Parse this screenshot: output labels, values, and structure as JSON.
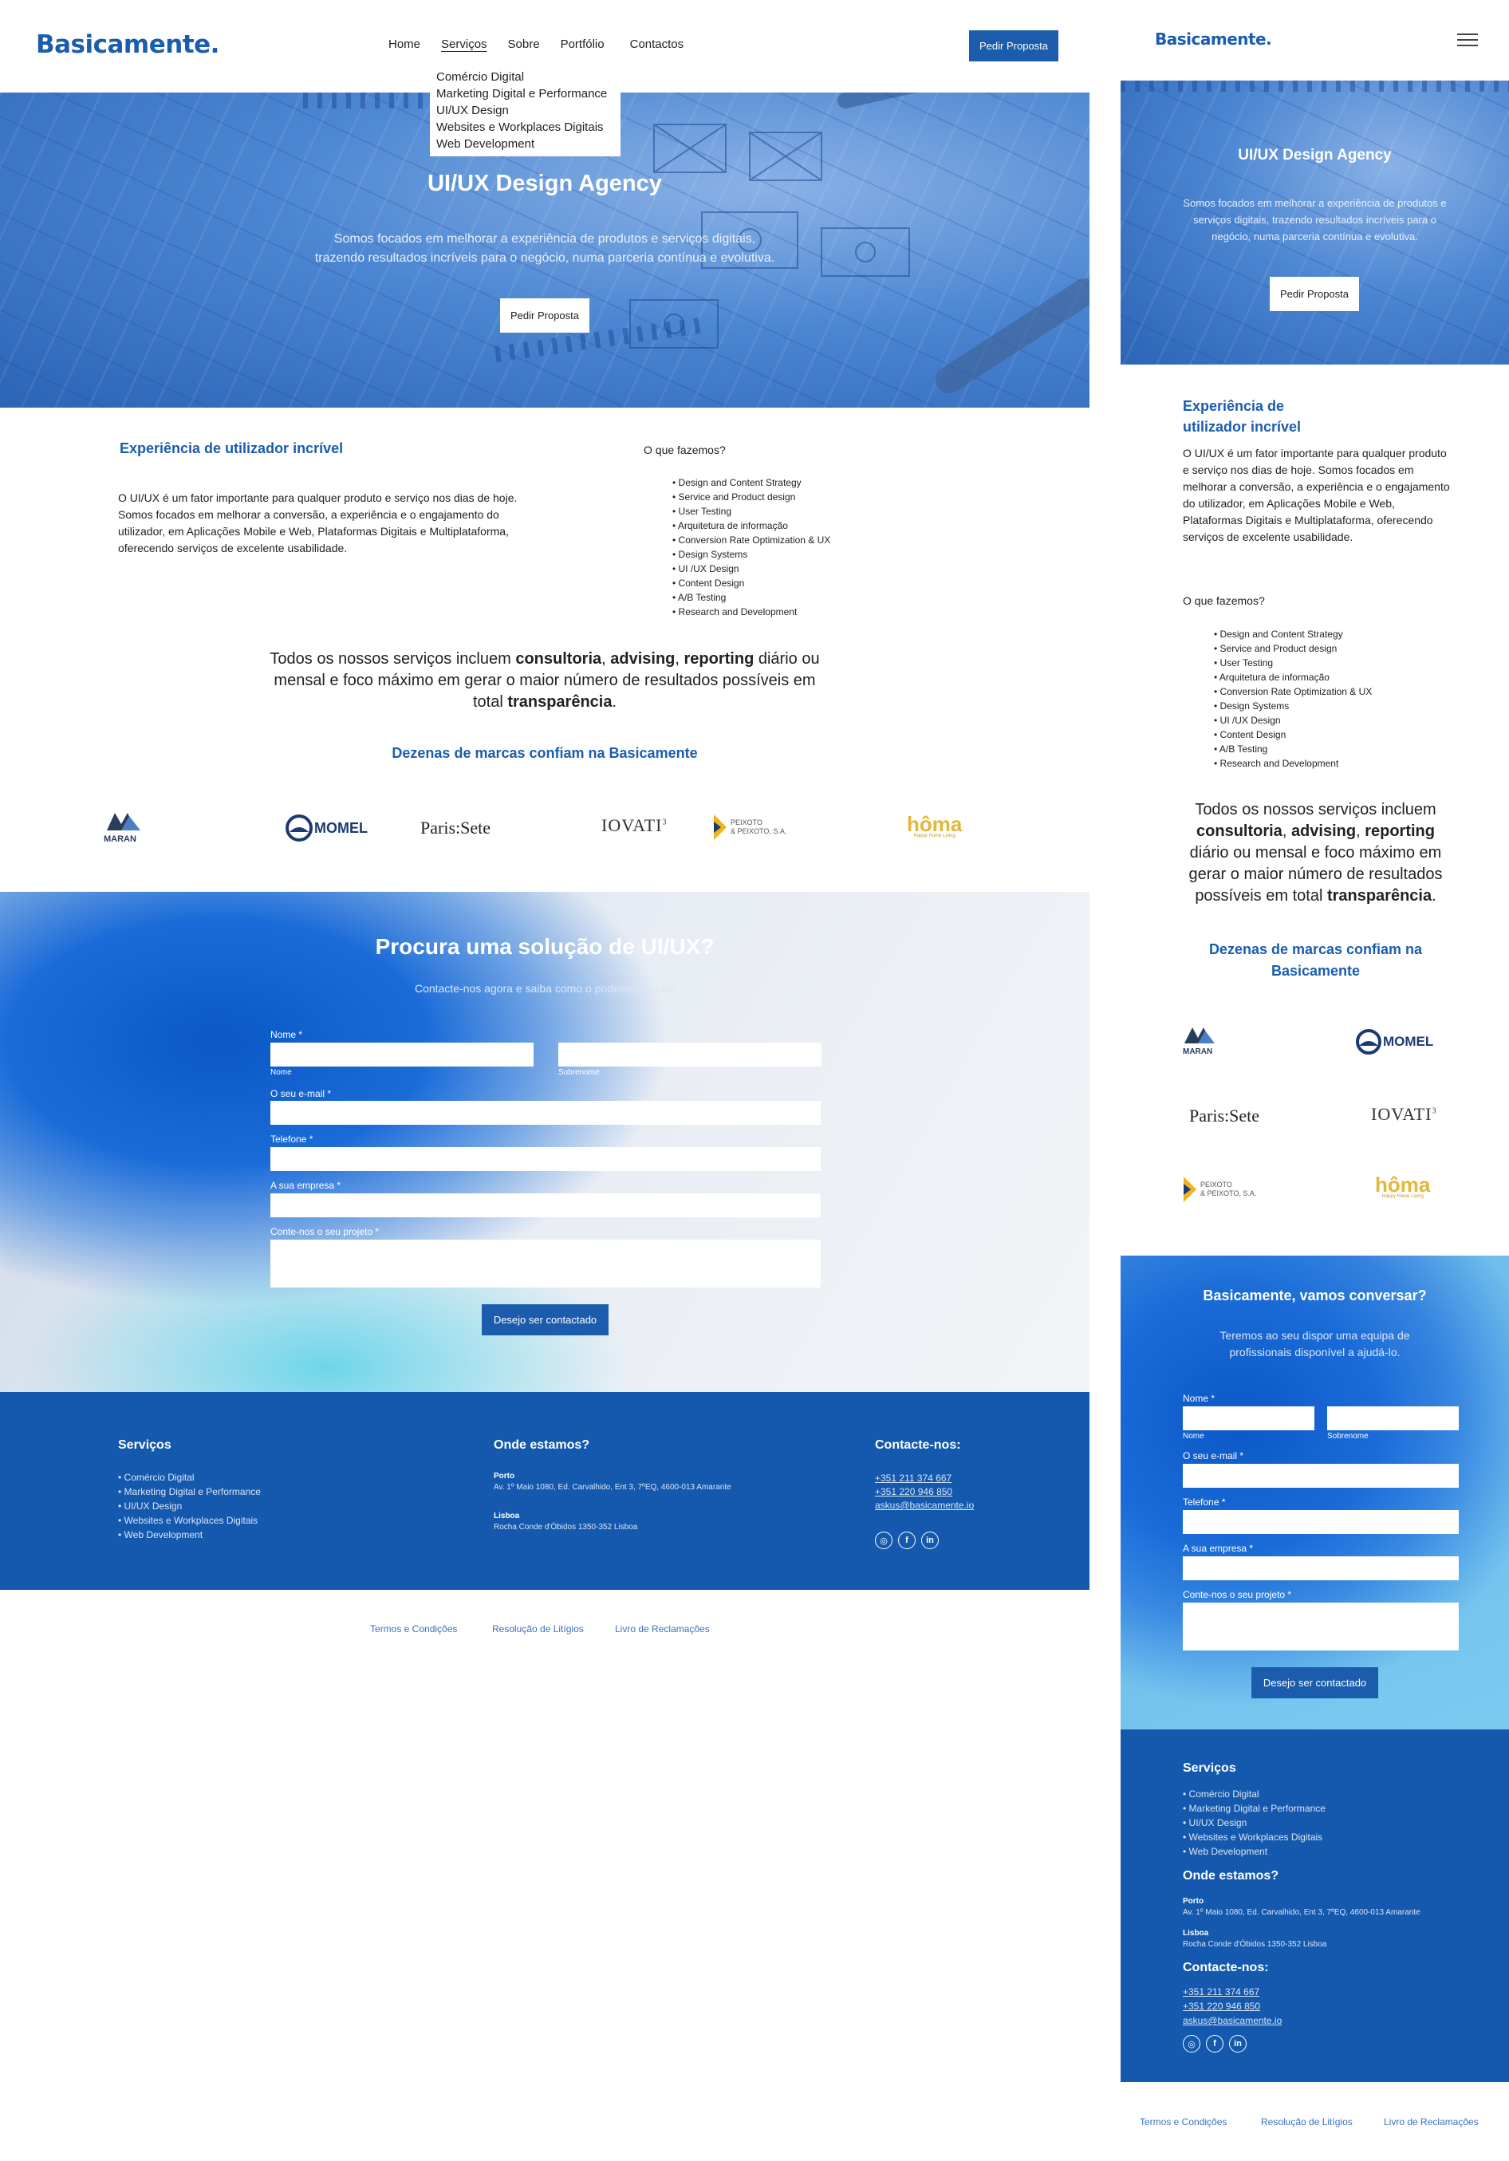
{
  "brand": {
    "name": "Basicamente",
    "dot": ".",
    "color": "#1a5cb0"
  },
  "nav": {
    "items": [
      "Home",
      "Serviços",
      "Sobre",
      "Portfólio",
      "Contactos"
    ],
    "cta": "Pedir Proposta",
    "active": "Serviços",
    "dropdown": [
      "Comércio Digital",
      "Marketing Digital e Performance",
      "UI/UX Design",
      "Websites e Workplaces Digitais",
      "Web Development"
    ]
  },
  "hero": {
    "title": "UI/UX Design Agency",
    "subtitle_line1": "Somos focados em melhorar a experiência de produtos e serviços digitais,",
    "subtitle_line2": "trazendo resultados incríveis para o negócio, numa parceria contínua e evolutiva.",
    "mobile_subtitle": "Somos focados em melhorar a experiência de produtos e serviços digitais, trazendo resultados incríveis para o negócio, numa parceria contínua e evolutiva.",
    "cta": "Pedir Proposta"
  },
  "intro": {
    "heading": "Experiência de utilizador incrível",
    "heading_m1": "Experiência de",
    "heading_m2": "utilizador incrível",
    "body": "O UI/UX é um fator importante para qualquer produto e serviço nos dias de hoje. Somos focados em melhorar a conversão, a experiência e o engajamento do utilizador, em Aplicações Mobile e Web, Plataformas Digitais e Multiplataforma, oferecendo serviços de excelente usabilidade.",
    "services_heading": "O que fazemos?",
    "services": [
      "Design and Content Strategy",
      "Service and Product design",
      "User Testing",
      "Arquitetura de informação",
      "Conversion Rate Optimization & UX",
      "Design Systems",
      "UI /UX Design",
      "Content Design",
      "A/B Testing",
      "Research and Development"
    ]
  },
  "statement": {
    "t1": "Todos os nossos serviços incluem ",
    "b1": "consultoria",
    "t2": ", ",
    "b2": "advising",
    "t3": ", ",
    "b3": "reporting",
    "t4": " diário ou mensal e foco máximo em gerar o maior número de resultados possíveis em total ",
    "b4": "transparência",
    "t5": "."
  },
  "brands": {
    "heading": "Dezenas de marcas confiam na Basicamente",
    "logos": [
      "MARAN",
      "MOMEL",
      "Paris:Sete",
      "IOVATI",
      "PEIXOTO & PEIXOTO, S.A.",
      "hôma"
    ],
    "iovati_sup": "3",
    "peixoto_l1": "PEIXOTO",
    "peixoto_l2": "& PEIXOTO, S.A.",
    "homa_tag": "Happy Home Living"
  },
  "contact": {
    "title": "Procura uma solução de UI/UX?",
    "subtitle": "Contacte-nos agora e saiba como o podemos ajudar",
    "mobile_title": "Basicamente, vamos conversar?",
    "mobile_subtitle": "Teremos ao seu dispor uma equipa de profissionais disponível a ajudá-lo.",
    "name_label": "Nome *",
    "first_sub": "Nome",
    "last_sub": "Sobrenome",
    "email_label": "O seu e-mail *",
    "phone_label": "Telefone *",
    "company_label": "A sua empresa *",
    "project_label": "Conte-nos o seu projeto *",
    "submit": "Desejo ser contactado"
  },
  "footer": {
    "services_heading": "Serviços",
    "services": [
      "Comércio Digital",
      "Marketing Digital e Performance",
      "UI/UX Design",
      "Websites e Workplaces Digitais",
      "Web Development"
    ],
    "location_heading": "Onde estamos?",
    "porto_label": "Porto",
    "porto_addr": "Av. 1º Maio 1080, Ed. Carvalhido, Ent 3, 7ºEQ, 4600-013 Amarante",
    "lisboa_label": "Lisboa",
    "lisboa_addr": "Rocha Conde d'Óbidos 1350-352 Lisboa",
    "contact_heading": "Contacte-nos:",
    "phone1": "+351 211 374 667",
    "phone2": "+351 220 946 850",
    "email": "askus@basicamente.io",
    "social": [
      "instagram",
      "facebook",
      "linkedin"
    ],
    "color": "#1459ad"
  },
  "legal": [
    "Termos e Condições",
    "Resolução de Litígios",
    "Livro de Reclamações"
  ]
}
